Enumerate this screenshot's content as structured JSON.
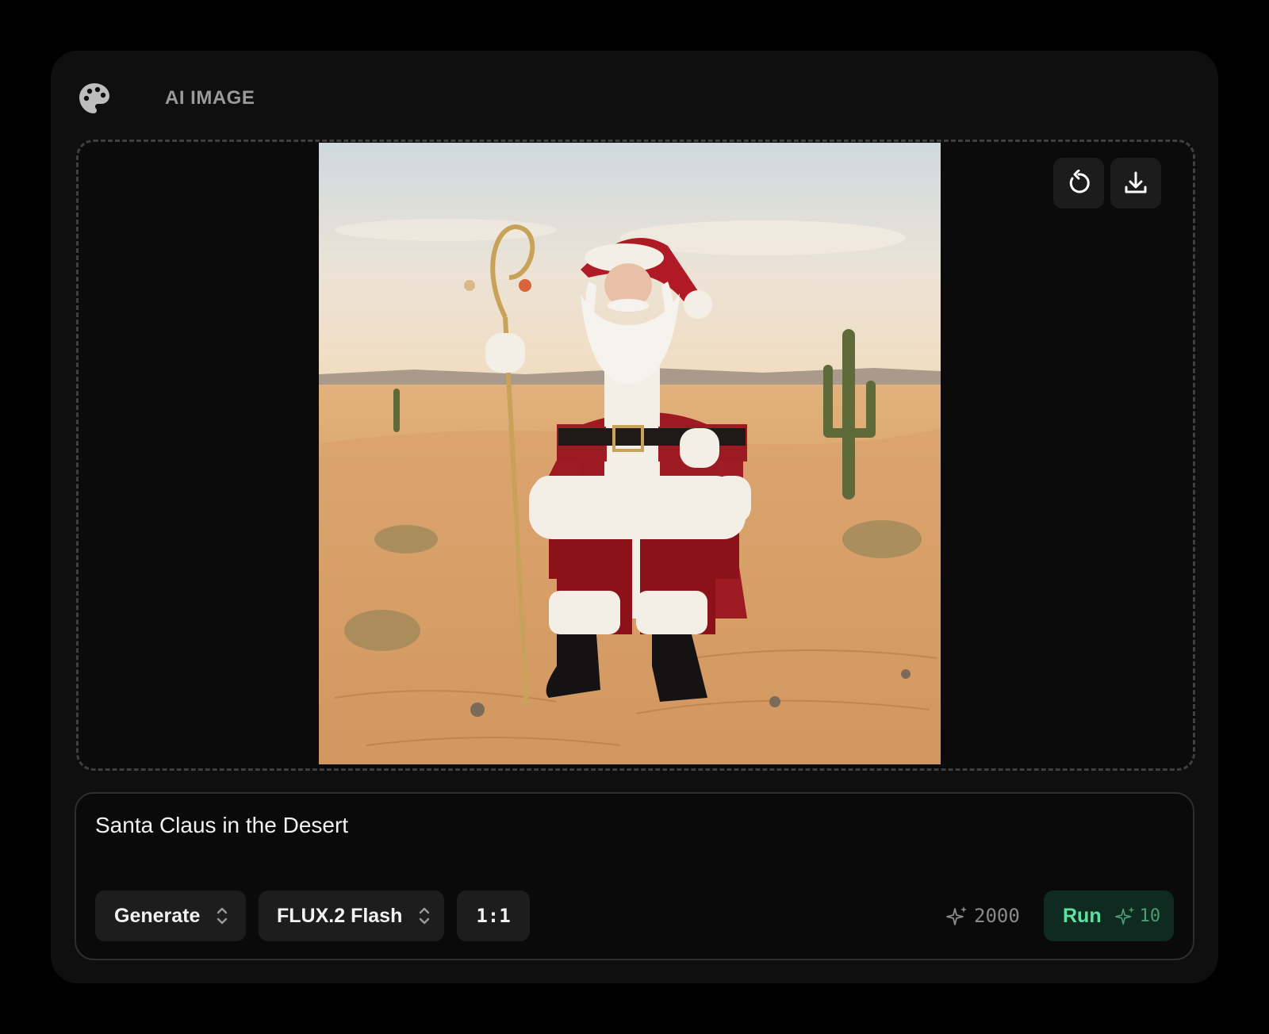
{
  "header": {
    "title": "AI IMAGE",
    "icon": "palette-icon"
  },
  "canvas": {
    "image_description_icon": "generated-image",
    "actions": {
      "refresh_icon": "refresh-icon",
      "download_icon": "download-icon"
    }
  },
  "prompt": {
    "text": "Santa Claus in the Desert"
  },
  "toolbar": {
    "mode": "Generate",
    "model": "FLUX.2 Flash",
    "ratio": "1:1",
    "credits": "2000",
    "run_label": "Run",
    "run_cost": "10"
  },
  "colors": {
    "accent": "#5ee0a0",
    "run_bg": "#0f2a20",
    "card_bg": "#0f0f0f"
  }
}
